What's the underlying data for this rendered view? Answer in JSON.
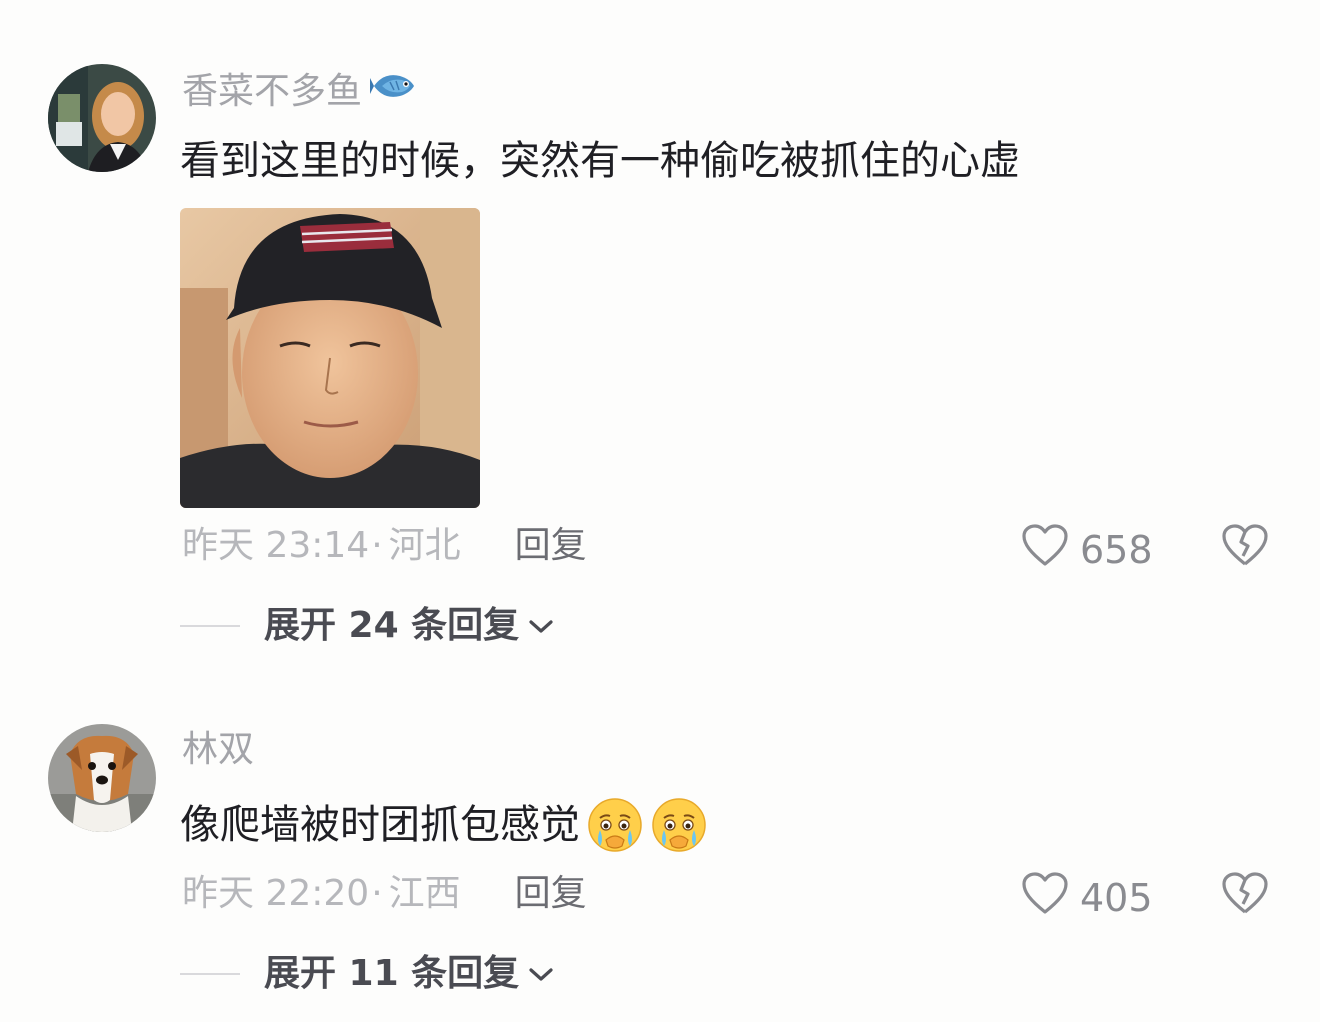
{
  "comments": [
    {
      "username": "香菜不多鱼",
      "username_emoji": "fish-icon",
      "text": "看到这里的时候，突然有一种偷吃被抓住的心虚",
      "has_image": true,
      "timestamp": "昨天 23:14",
      "separator": "·",
      "location": "河北",
      "reply_label": "回复",
      "likes": "658",
      "expand_label": "展开 24 条回复"
    },
    {
      "username": "林双",
      "text": "像爬墙被时团抓包感觉",
      "text_emojis": [
        "crying-face-emoji",
        "crying-face-emoji"
      ],
      "timestamp": "昨天 22:20",
      "separator": "·",
      "location": "江西",
      "reply_label": "回复",
      "likes": "405",
      "expand_label": "展开 11 条回复"
    }
  ],
  "colors": {
    "background": "#fdfdfc",
    "username": "#a3a4a9",
    "text": "#1f1f24",
    "meta": "#b6b7bb",
    "expand": "#4a4b52"
  }
}
